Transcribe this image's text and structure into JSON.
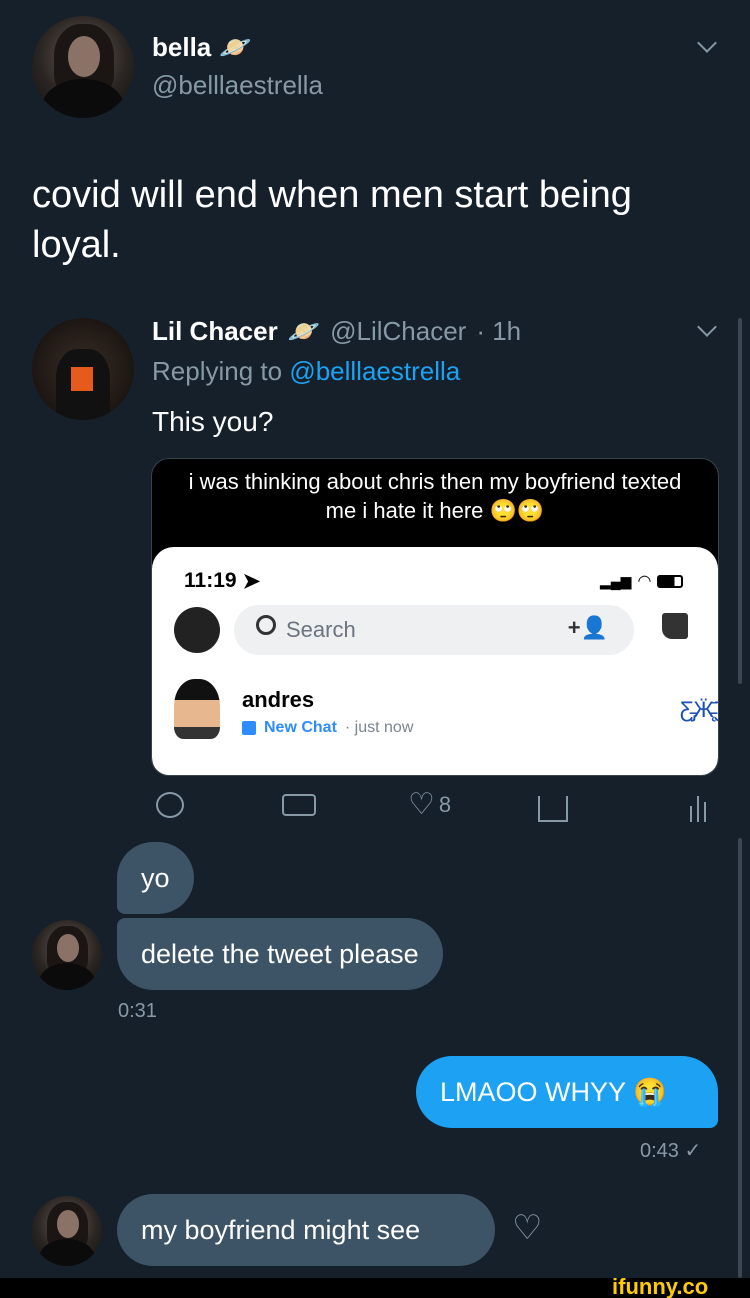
{
  "tweet": {
    "author_name": "bella",
    "author_handle": "@belllaestrella",
    "text": "covid will end when men start being loyal."
  },
  "reply": {
    "author_name": "Lil Chacer",
    "author_handle": "@LilChacer",
    "time": "· 1h",
    "replying_prefix": "Replying to",
    "replying_handle": "@belllaestrella",
    "text": "This you?",
    "embed": {
      "caption_line1": "i was thinking about chris then my boyfriend texted",
      "caption_line2": "me i hate it here 🙄🙄",
      "phone_time": "11:19",
      "search_placeholder": "Search",
      "contact_name": "andres",
      "chat_status": "New Chat",
      "chat_time": "· just now"
    },
    "actions": {
      "like_count": "8"
    }
  },
  "dm": {
    "messages": [
      {
        "text": "yo"
      },
      {
        "text": "delete the tweet please"
      },
      {
        "text": "0:31"
      },
      {
        "text": "LMAOO WHYY 😭"
      },
      {
        "text": "0:43 ✓"
      },
      {
        "text": "my boyfriend might  see"
      }
    ]
  },
  "watermark": "ifunny.co",
  "colors": {
    "background": "#15202b",
    "accent": "#1da1f2",
    "muted": "#8899a6",
    "incoming_bubble": "#3d5466"
  }
}
